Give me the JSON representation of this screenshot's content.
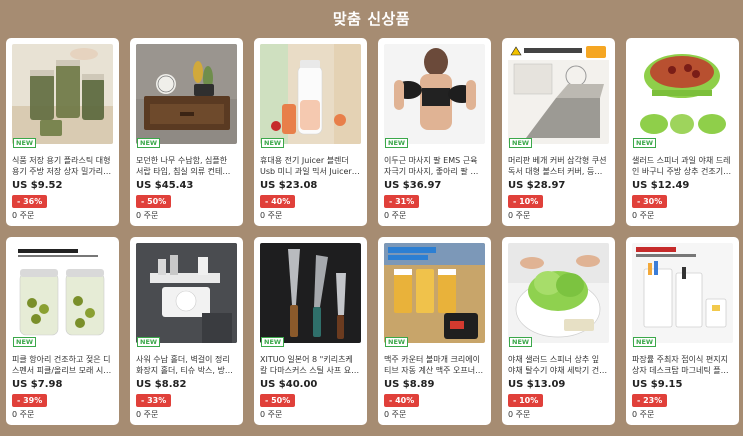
{
  "header": {
    "title": "맞춤 신상품"
  },
  "badge_label": "NEW",
  "products": [
    {
      "title": "식품 저장 용기 플라스틱 대형 용기 주방 저장 상자 밀가리 ...",
      "price": "US $9.52",
      "discount": "- 36%",
      "orders": "0 주문",
      "image": "storage-jars"
    },
    {
      "title": "모던한 나무 수납함, 심플한 서랍 타입, 침실 의류 컨테이너, ...",
      "price": "US $45.43",
      "discount": "- 50%",
      "orders": "0 주문",
      "image": "wooden-drawer"
    },
    {
      "title": "휴대용 전기 Juicer 블렌더 Usb 미니 과일 믹서 Juicers 과일 ...",
      "price": "US $23.08",
      "discount": "- 40%",
      "orders": "0 주문",
      "image": "juicer-bottle"
    },
    {
      "title": "이두근 마사지 팔 EMS 근육 자극기 마사지, 좋아리 팔 피트 ...",
      "price": "US $36.97",
      "discount": "- 31%",
      "orders": "0 주문",
      "image": "arm-massager"
    },
    {
      "title": "머리판 베개 커버 삼각형 쿠션 독서 대형 볼스터 커버, 등받 ...",
      "price": "US $28.97",
      "discount": "- 10%",
      "orders": "0 주문",
      "image": "cushion-cover"
    },
    {
      "title": "샐러드 스피너 과일 야채 드레인 바구니 주방 상추 건조기, ...",
      "price": "US $12.49",
      "discount": "- 30%",
      "orders": "0 주문",
      "image": "salad-spinner-green"
    },
    {
      "title": "피클 항아리 건조하고 젖은 디스펜서 피클/올리브 모래 시 ...",
      "price": "US $7.98",
      "discount": "- 39%",
      "orders": "0 주문",
      "image": "pickle-jar"
    },
    {
      "title": "사워 수납 홀더, 벽걸이 정리 화장지 홀더, 티슈 박스, 방수 랙 ...",
      "price": "US $8.82",
      "discount": "- 33%",
      "orders": "0 주문",
      "image": "bathroom-shelf"
    },
    {
      "title": "XITUO 일본어 8 \"키리츠케 칼 다마스커스 스틸 사프 요리사 ...",
      "price": "US $40.00",
      "discount": "- 50%",
      "orders": "0 주문",
      "image": "knives"
    },
    {
      "title": "맥주 카운터 볼마개 크리에이티브 자동 계산 맥주 오프너 ...",
      "price": "US $8.89",
      "discount": "- 40%",
      "orders": "0 주문",
      "image": "beer-opener"
    },
    {
      "title": "야채 샐러드 스피너 상추 잎 야채 탈수기 야채 세탁기 건조 ...",
      "price": "US $13.09",
      "discount": "- 10%",
      "orders": "0 주문",
      "image": "lettuce-spinner"
    },
    {
      "title": "파장률 주최자 접이식 편지지 상자 데스크탑 마그네틱 플라 ...",
      "price": "US $9.15",
      "discount": "- 23%",
      "orders": "0 주문",
      "image": "desk-organizer"
    }
  ]
}
